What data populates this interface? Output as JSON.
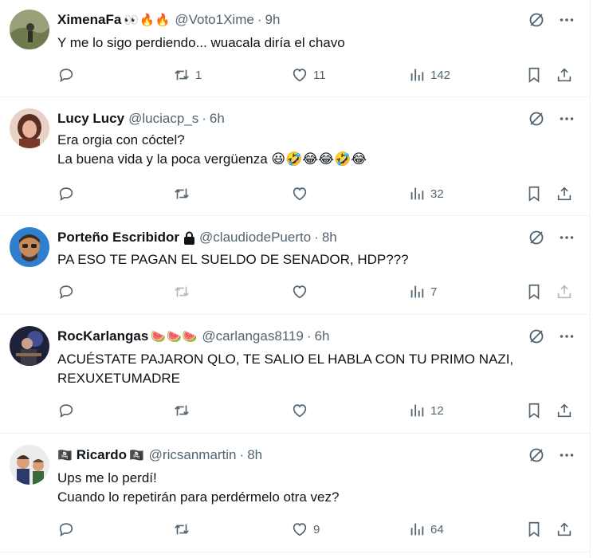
{
  "tweets": [
    {
      "name": "XimenaFa",
      "badges": "👀🔥🔥",
      "handle": "@Voto1Xime",
      "time": "9h",
      "lines": [
        "Y me lo sigo perdiendo... wuacala diría el chavo"
      ],
      "replies": "",
      "retweets": "1",
      "likes": "11",
      "views": "142",
      "avatar_color": "#8a8f6a"
    },
    {
      "name": "Lucy Lucy",
      "badges": "",
      "handle": "@luciacp_s",
      "time": "6h",
      "lines": [
        "Era orgia con cóctel?",
        "La buena vida y la poca vergüenza 😃🤣😂😂🤣😂"
      ],
      "replies": "",
      "retweets": "",
      "likes": "",
      "views": "32",
      "avatar_color": "#7a4a3a"
    },
    {
      "name": "Porteño Escribidor",
      "badges": "",
      "handle": "@claudiodePuerto",
      "time": "8h",
      "lines": [
        "PA ESO TE PAGAN EL SUELDO DE SENADOR, HDP???"
      ],
      "replies": "",
      "retweets": "",
      "likes": "",
      "views": "7",
      "avatar_color": "#2f7fd0",
      "protected": true
    },
    {
      "name": "RocKarlangas",
      "badges": "🍉🍉🍉",
      "handle": "@carlangas8119",
      "time": "6h",
      "lines": [
        "ACUÉSTATE PAJARON QLO, TE SALIO EL HABLA CON TU PRIMO NAZI,",
        "REXUXETUMADRE"
      ],
      "replies": "",
      "retweets": "",
      "likes": "",
      "views": "12",
      "avatar_color": "#2a2f4a"
    },
    {
      "name": "Ricardo",
      "name_prefix": "🏴‍☠️",
      "name_suffix": "🏴‍☠️",
      "badges": "",
      "handle": "@ricsanmartin",
      "time": "8h",
      "lines": [
        "Ups me lo perdí!",
        "Cuando lo repetirán para perdérmelo otra vez?"
      ],
      "replies": "",
      "retweets": "",
      "likes": "9",
      "views": "64",
      "avatar_color": "#d8d8d8"
    }
  ],
  "separator": "·",
  "colors": {
    "text": "#0f1419",
    "muted": "#536471",
    "border": "#eff3f4"
  }
}
